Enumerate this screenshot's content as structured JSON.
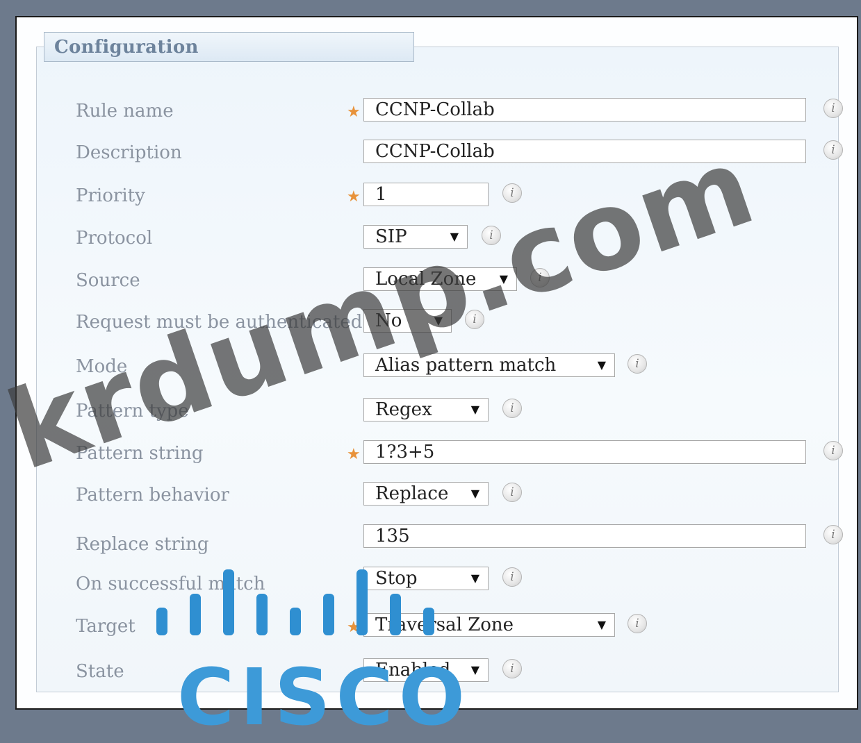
{
  "panel": {
    "title": "Configuration"
  },
  "form": {
    "rule_name": {
      "label": "Rule name",
      "value": "CCNP-Collab",
      "required": true
    },
    "description": {
      "label": "Description",
      "value": "CCNP-Collab"
    },
    "priority": {
      "label": "Priority",
      "value": "1",
      "required": true
    },
    "protocol": {
      "label": "Protocol",
      "value": "SIP"
    },
    "source": {
      "label": "Source",
      "value": "Local Zone"
    },
    "request_auth": {
      "label": "Request must be authenticated",
      "value": "No"
    },
    "mode": {
      "label": "Mode",
      "value": "Alias pattern match"
    },
    "pattern_type": {
      "label": "Pattern type",
      "value": "Regex"
    },
    "pattern_string": {
      "label": "Pattern string",
      "value": "1?3+5",
      "required": true
    },
    "pattern_behavior": {
      "label": "Pattern behavior",
      "value": "Replace"
    },
    "replace_string": {
      "label": "Replace string",
      "value": "135"
    },
    "on_success": {
      "label": "On successful match",
      "value": "Stop"
    },
    "target": {
      "label": "Target",
      "value": "Traversal Zone",
      "required": true
    },
    "state": {
      "label": "State",
      "value": "Enabled"
    }
  },
  "icons": {
    "required": "★",
    "info": "i",
    "dropdown": "▼"
  },
  "overlays": {
    "watermark": "krdump.com",
    "logo_text": "CISCO"
  },
  "colors": {
    "required_star": "#e8923a",
    "label_text": "#8a93a0",
    "panel_title": "#6d839c",
    "logo": "#2f8fd1"
  }
}
